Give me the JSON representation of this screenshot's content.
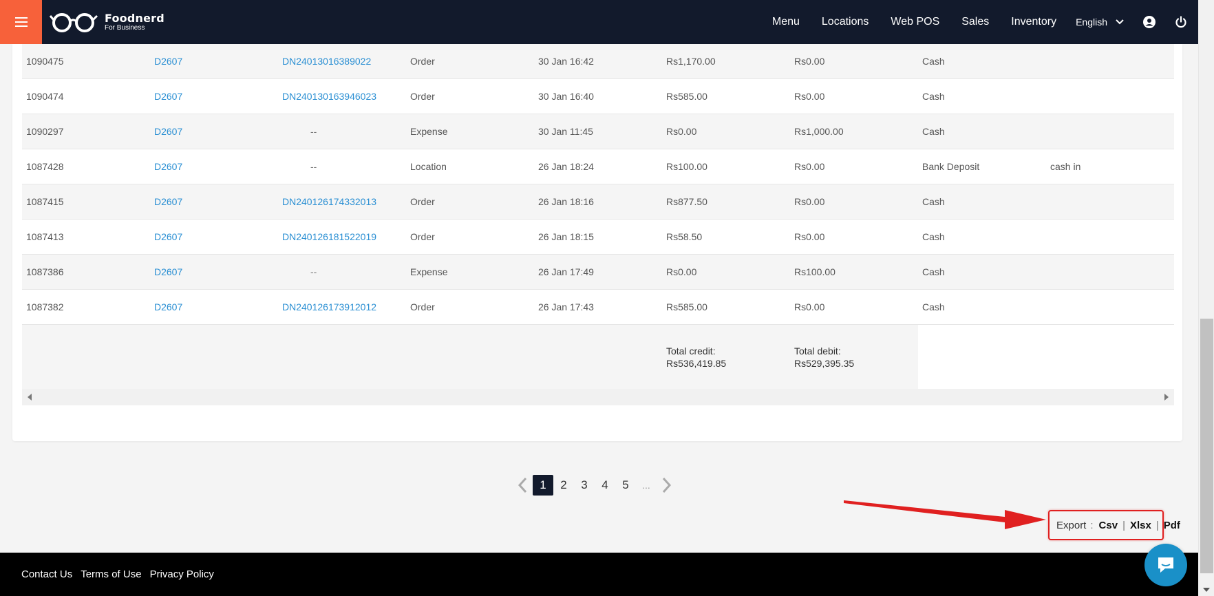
{
  "header": {
    "logo_name": "Foodnerd",
    "logo_sub": "For Business",
    "nav": [
      "Menu",
      "Locations",
      "Web POS",
      "Sales",
      "Inventory"
    ],
    "language": "English"
  },
  "table": {
    "rows": [
      {
        "id": "1090475",
        "user": "D2607",
        "order_no": "DN24013016389022",
        "type": "Order",
        "date": "30 Jan 16:42",
        "credit": "Rs1,170.00",
        "debit": "Rs0.00",
        "method": "Cash",
        "note": ""
      },
      {
        "id": "1090474",
        "user": "D2607",
        "order_no": "DN240130163946023",
        "type": "Order",
        "date": "30 Jan 16:40",
        "credit": "Rs585.00",
        "debit": "Rs0.00",
        "method": "Cash",
        "note": ""
      },
      {
        "id": "1090297",
        "user": "D2607",
        "order_no": "--",
        "type": "Expense",
        "date": "30 Jan 11:45",
        "credit": "Rs0.00",
        "debit": "Rs1,000.00",
        "method": "Cash",
        "note": ""
      },
      {
        "id": "1087428",
        "user": "D2607",
        "order_no": "--",
        "type": "Location",
        "date": "26 Jan 18:24",
        "credit": "Rs100.00",
        "debit": "Rs0.00",
        "method": "Bank Deposit",
        "note": "cash in"
      },
      {
        "id": "1087415",
        "user": "D2607",
        "order_no": "DN240126174332013",
        "type": "Order",
        "date": "26 Jan 18:16",
        "credit": "Rs877.50",
        "debit": "Rs0.00",
        "method": "Cash",
        "note": ""
      },
      {
        "id": "1087413",
        "user": "D2607",
        "order_no": "DN240126181522019",
        "type": "Order",
        "date": "26 Jan 18:15",
        "credit": "Rs58.50",
        "debit": "Rs0.00",
        "method": "Cash",
        "note": ""
      },
      {
        "id": "1087386",
        "user": "D2607",
        "order_no": "--",
        "type": "Expense",
        "date": "26 Jan 17:49",
        "credit": "Rs0.00",
        "debit": "Rs100.00",
        "method": "Cash",
        "note": ""
      },
      {
        "id": "1087382",
        "user": "D2607",
        "order_no": "DN240126173912012",
        "type": "Order",
        "date": "26 Jan 17:43",
        "credit": "Rs585.00",
        "debit": "Rs0.00",
        "method": "Cash",
        "note": ""
      }
    ],
    "total_credit_label": "Total credit:",
    "total_credit_value": "Rs536,419.85",
    "total_debit_label": "Total debit:",
    "total_debit_value": "Rs529,395.35"
  },
  "pagination": {
    "pages": [
      "1",
      "2",
      "3",
      "4",
      "5"
    ],
    "ellipsis": "...",
    "active": "1"
  },
  "export": {
    "label": "Export",
    "colon": ":",
    "csv": "Csv",
    "xlsx": "Xlsx",
    "pdf": "Pdf",
    "separator": "|"
  },
  "footer": {
    "links": [
      "Contact Us",
      "Terms of Use",
      "Privacy Policy"
    ]
  },
  "colors": {
    "header_bg": "#121a2c",
    "accent": "#f7613a",
    "link": "#2a8fd3",
    "highlight": "#e02020"
  }
}
